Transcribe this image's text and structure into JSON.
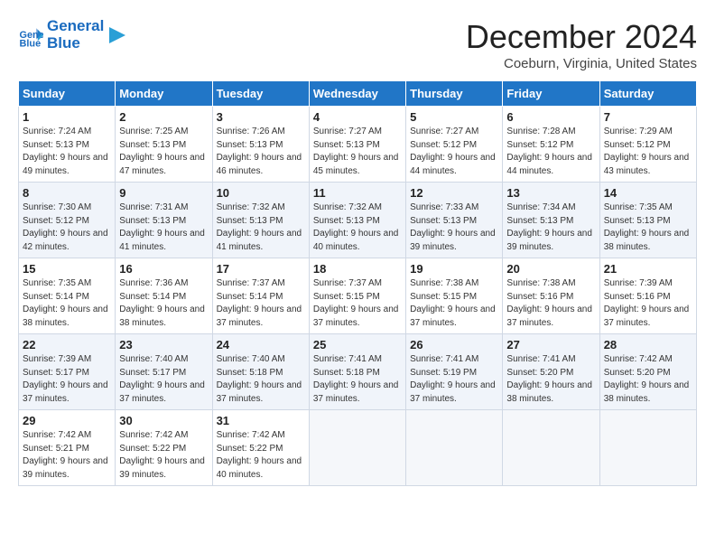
{
  "app": {
    "name": "GeneralBlue",
    "logo_symbol": "▶"
  },
  "calendar": {
    "title": "December 2024",
    "location": "Coeburn, Virginia, United States",
    "days_of_week": [
      "Sunday",
      "Monday",
      "Tuesday",
      "Wednesday",
      "Thursday",
      "Friday",
      "Saturday"
    ],
    "weeks": [
      [
        null,
        null,
        {
          "day": 1,
          "sunrise": "Sunrise: 7:24 AM",
          "sunset": "Sunset: 5:13 PM",
          "daylight": "Daylight: 9 hours and 49 minutes."
        },
        {
          "day": 2,
          "sunrise": "Sunrise: 7:25 AM",
          "sunset": "Sunset: 5:13 PM",
          "daylight": "Daylight: 9 hours and 47 minutes."
        },
        {
          "day": 3,
          "sunrise": "Sunrise: 7:26 AM",
          "sunset": "Sunset: 5:13 PM",
          "daylight": "Daylight: 9 hours and 46 minutes."
        },
        {
          "day": 4,
          "sunrise": "Sunrise: 7:27 AM",
          "sunset": "Sunset: 5:13 PM",
          "daylight": "Daylight: 9 hours and 45 minutes."
        },
        {
          "day": 5,
          "sunrise": "Sunrise: 7:27 AM",
          "sunset": "Sunset: 5:12 PM",
          "daylight": "Daylight: 9 hours and 44 minutes."
        },
        {
          "day": 6,
          "sunrise": "Sunrise: 7:28 AM",
          "sunset": "Sunset: 5:12 PM",
          "daylight": "Daylight: 9 hours and 44 minutes."
        },
        {
          "day": 7,
          "sunrise": "Sunrise: 7:29 AM",
          "sunset": "Sunset: 5:12 PM",
          "daylight": "Daylight: 9 hours and 43 minutes."
        }
      ],
      [
        {
          "day": 8,
          "sunrise": "Sunrise: 7:30 AM",
          "sunset": "Sunset: 5:12 PM",
          "daylight": "Daylight: 9 hours and 42 minutes."
        },
        {
          "day": 9,
          "sunrise": "Sunrise: 7:31 AM",
          "sunset": "Sunset: 5:13 PM",
          "daylight": "Daylight: 9 hours and 41 minutes."
        },
        {
          "day": 10,
          "sunrise": "Sunrise: 7:32 AM",
          "sunset": "Sunset: 5:13 PM",
          "daylight": "Daylight: 9 hours and 41 minutes."
        },
        {
          "day": 11,
          "sunrise": "Sunrise: 7:32 AM",
          "sunset": "Sunset: 5:13 PM",
          "daylight": "Daylight: 9 hours and 40 minutes."
        },
        {
          "day": 12,
          "sunrise": "Sunrise: 7:33 AM",
          "sunset": "Sunset: 5:13 PM",
          "daylight": "Daylight: 9 hours and 39 minutes."
        },
        {
          "day": 13,
          "sunrise": "Sunrise: 7:34 AM",
          "sunset": "Sunset: 5:13 PM",
          "daylight": "Daylight: 9 hours and 39 minutes."
        },
        {
          "day": 14,
          "sunrise": "Sunrise: 7:35 AM",
          "sunset": "Sunset: 5:13 PM",
          "daylight": "Daylight: 9 hours and 38 minutes."
        }
      ],
      [
        {
          "day": 15,
          "sunrise": "Sunrise: 7:35 AM",
          "sunset": "Sunset: 5:14 PM",
          "daylight": "Daylight: 9 hours and 38 minutes."
        },
        {
          "day": 16,
          "sunrise": "Sunrise: 7:36 AM",
          "sunset": "Sunset: 5:14 PM",
          "daylight": "Daylight: 9 hours and 38 minutes."
        },
        {
          "day": 17,
          "sunrise": "Sunrise: 7:37 AM",
          "sunset": "Sunset: 5:14 PM",
          "daylight": "Daylight: 9 hours and 37 minutes."
        },
        {
          "day": 18,
          "sunrise": "Sunrise: 7:37 AM",
          "sunset": "Sunset: 5:15 PM",
          "daylight": "Daylight: 9 hours and 37 minutes."
        },
        {
          "day": 19,
          "sunrise": "Sunrise: 7:38 AM",
          "sunset": "Sunset: 5:15 PM",
          "daylight": "Daylight: 9 hours and 37 minutes."
        },
        {
          "day": 20,
          "sunrise": "Sunrise: 7:38 AM",
          "sunset": "Sunset: 5:16 PM",
          "daylight": "Daylight: 9 hours and 37 minutes."
        },
        {
          "day": 21,
          "sunrise": "Sunrise: 7:39 AM",
          "sunset": "Sunset: 5:16 PM",
          "daylight": "Daylight: 9 hours and 37 minutes."
        }
      ],
      [
        {
          "day": 22,
          "sunrise": "Sunrise: 7:39 AM",
          "sunset": "Sunset: 5:17 PM",
          "daylight": "Daylight: 9 hours and 37 minutes."
        },
        {
          "day": 23,
          "sunrise": "Sunrise: 7:40 AM",
          "sunset": "Sunset: 5:17 PM",
          "daylight": "Daylight: 9 hours and 37 minutes."
        },
        {
          "day": 24,
          "sunrise": "Sunrise: 7:40 AM",
          "sunset": "Sunset: 5:18 PM",
          "daylight": "Daylight: 9 hours and 37 minutes."
        },
        {
          "day": 25,
          "sunrise": "Sunrise: 7:41 AM",
          "sunset": "Sunset: 5:18 PM",
          "daylight": "Daylight: 9 hours and 37 minutes."
        },
        {
          "day": 26,
          "sunrise": "Sunrise: 7:41 AM",
          "sunset": "Sunset: 5:19 PM",
          "daylight": "Daylight: 9 hours and 37 minutes."
        },
        {
          "day": 27,
          "sunrise": "Sunrise: 7:41 AM",
          "sunset": "Sunset: 5:20 PM",
          "daylight": "Daylight: 9 hours and 38 minutes."
        },
        {
          "day": 28,
          "sunrise": "Sunrise: 7:42 AM",
          "sunset": "Sunset: 5:20 PM",
          "daylight": "Daylight: 9 hours and 38 minutes."
        }
      ],
      [
        {
          "day": 29,
          "sunrise": "Sunrise: 7:42 AM",
          "sunset": "Sunset: 5:21 PM",
          "daylight": "Daylight: 9 hours and 39 minutes."
        },
        {
          "day": 30,
          "sunrise": "Sunrise: 7:42 AM",
          "sunset": "Sunset: 5:22 PM",
          "daylight": "Daylight: 9 hours and 39 minutes."
        },
        {
          "day": 31,
          "sunrise": "Sunrise: 7:42 AM",
          "sunset": "Sunset: 5:22 PM",
          "daylight": "Daylight: 9 hours and 40 minutes."
        },
        null,
        null,
        null,
        null
      ]
    ]
  }
}
